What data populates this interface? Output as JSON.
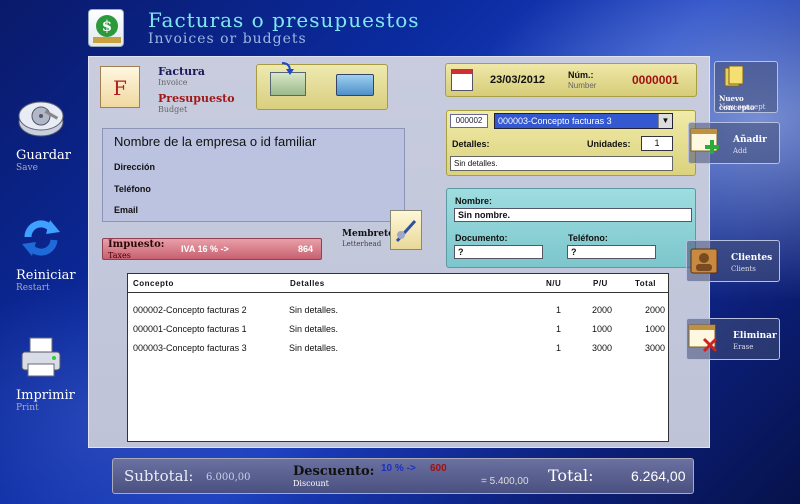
{
  "header": {
    "title": "Facturas o presupuestos",
    "subtitle": "Invoices or budgets"
  },
  "sidebar": {
    "save": {
      "label": "Guardar",
      "sub": "Save"
    },
    "restart": {
      "label": "Reiniciar",
      "sub": "Restart"
    },
    "print": {
      "label": "Imprimir",
      "sub": "Print"
    }
  },
  "doc_type": {
    "icon_letter": "F",
    "invoice": {
      "label": "Factura",
      "sub": "Invoice"
    },
    "budget": {
      "label": "Presupuesto",
      "sub": "Budget"
    }
  },
  "client": {
    "name": "Nombre de la empresa o id familiar",
    "address_label": "Dirección",
    "phone_label": "Teléfono",
    "email_label": "Email"
  },
  "tax": {
    "label": "Impuesto:",
    "sub": "Taxes",
    "rate": "IVA 16 % ->",
    "value": "864"
  },
  "letterhead": {
    "label": "Membrete",
    "sub": "Letterhead"
  },
  "invoice_meta": {
    "date": "23/03/2012",
    "number_label": "Núm.:",
    "number_sub": "Number",
    "number_value": "0000001"
  },
  "concept": {
    "code": "000002",
    "selected": "000003-Concepto facturas 3",
    "details_label": "Detalles:",
    "units_label": "Unidades:",
    "units_value": "1",
    "details_value": "Sin detalles."
  },
  "contact": {
    "name_label": "Nombre:",
    "name_value": "Sin nombre.",
    "document_label": "Documento:",
    "document_value": "?",
    "phone_label": "Teléfono:",
    "phone_value": "?"
  },
  "actions": {
    "new_concept": {
      "label": "Nuevo concepto",
      "sub": "New concept"
    },
    "add": {
      "label": "Añadir",
      "sub": "Add"
    },
    "clients": {
      "label": "Clientes",
      "sub": "Clients"
    },
    "erase": {
      "label": "Eliminar",
      "sub": "Erase"
    }
  },
  "table": {
    "headers": {
      "concept": "Concepto",
      "details": "Detalles",
      "nu": "N/U",
      "pu": "P/U",
      "total": "Total"
    },
    "rows": [
      {
        "concept": "000002-Concepto facturas 2",
        "details": "Sin detalles.",
        "nu": "1",
        "pu": "2000",
        "total": "2000"
      },
      {
        "concept": "000001-Concepto facturas 1",
        "details": "Sin detalles.",
        "nu": "1",
        "pu": "1000",
        "total": "1000"
      },
      {
        "concept": "000003-Concepto facturas 3",
        "details": "Sin detalles.",
        "nu": "1",
        "pu": "3000",
        "total": "3000"
      }
    ]
  },
  "footer": {
    "subtotal_label": "Subtotal:",
    "subtotal_value": "6.000,00",
    "discount_label": "Descuento:",
    "discount_sub": "Discount",
    "discount_rate": "10 % ->",
    "discount_value": "600",
    "discounted_total": "= 5.400,00",
    "total_label": "Total:",
    "total_value": "6.264,00"
  },
  "colors": {
    "accent_title": "#7fe6f2",
    "number_red": "#a01010",
    "tax_bar": "#c86070",
    "discount_blue": "#1830c0"
  }
}
